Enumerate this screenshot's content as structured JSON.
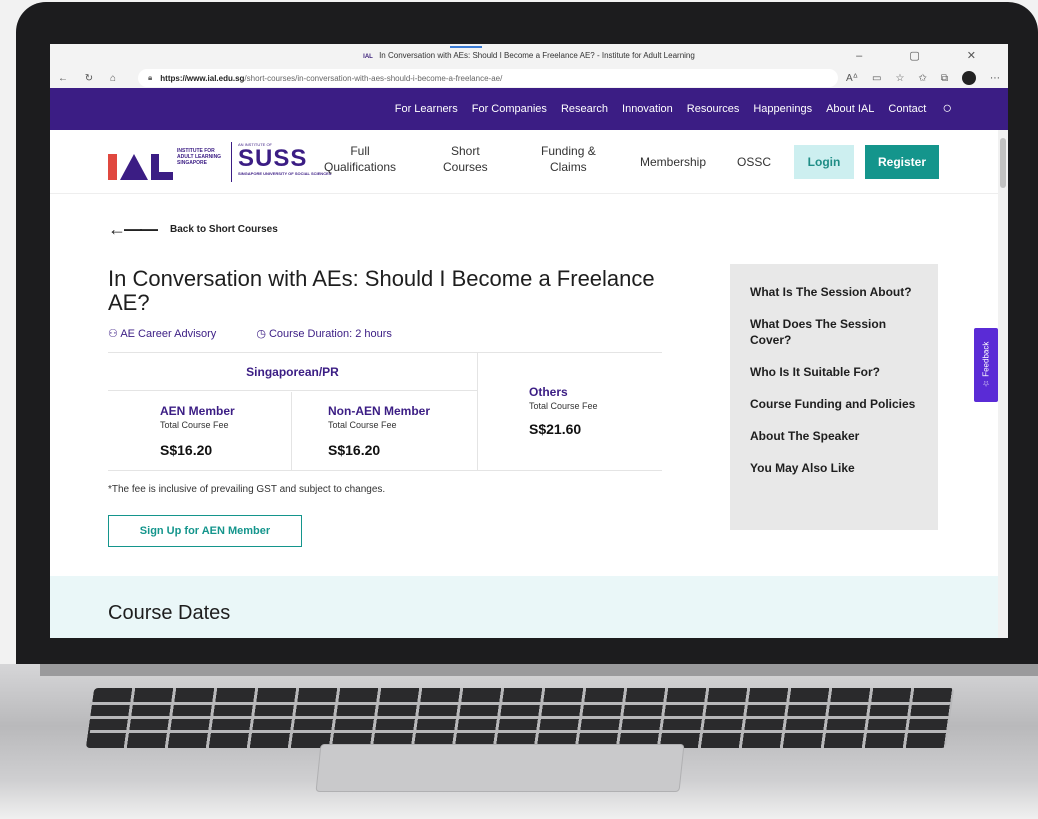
{
  "browser": {
    "tab_title": "In Conversation with AEs: Should I Become a Freelance AE? - Institute for Adult Learning",
    "tab_icon_text": "IAL",
    "window_controls": "–  ▢  ✕",
    "url_host": "https://www.ial.edu.sg",
    "url_path": "/short-courses/in-conversation-with-aes-should-i-become-a-freelance-ae/"
  },
  "topnav": {
    "items": [
      "For Learners",
      "For Companies",
      "Research",
      "Innovation",
      "Resources",
      "Happenings",
      "About IAL",
      "Contact"
    ]
  },
  "logo": {
    "ial_sub": "INSTITUTE FOR ADULT LEARNING SINGAPORE",
    "suss_small": "AN INSTITUTE OF",
    "suss_word": "SUSS",
    "suss_sub": "SINGAPORE UNIVERSITY OF SOCIAL SCIENCES"
  },
  "mainnav": {
    "full_qual_1": "Full",
    "full_qual_2": "Qualifications",
    "short_1": "Short",
    "short_2": "Courses",
    "funding_1": "Funding &",
    "funding_2": "Claims",
    "membership": "Membership",
    "ossc": "OSSC",
    "login": "Login",
    "register": "Register"
  },
  "back_link": "Back to Short Courses",
  "course": {
    "title": "In Conversation with AEs: Should I Become a Freelance AE?",
    "category": "AE Career Advisory",
    "duration": "Course Duration: 2 hours"
  },
  "fees": {
    "sgpr_heading": "Singaporean/PR",
    "aen_heading": "AEN Member",
    "aen_label": "Total Course Fee",
    "aen_value": "S$16.20",
    "non_aen_heading": "Non-AEN Member",
    "non_aen_label": "Total Course Fee",
    "non_aen_value": "S$16.20",
    "others_heading": "Others",
    "others_label": "Total Course Fee",
    "others_value": "S$21.60",
    "note": "*The fee is inclusive of prevailing GST and subject to changes."
  },
  "signup_button": "Sign Up for AEN Member",
  "sidebar": {
    "links": [
      "What Is The Session About?",
      "What Does The Session Cover?",
      "Who Is It Suitable For?",
      "Course Funding and Policies",
      "About The Speaker",
      "You May Also Like"
    ]
  },
  "feedback_tab": "☆ Feedback",
  "course_dates_heading": "Course Dates",
  "colors": {
    "brand_purple": "#3b1d84",
    "teal": "#14958c",
    "login_bg": "#cdeff0",
    "feedback": "#5a2bd6"
  }
}
